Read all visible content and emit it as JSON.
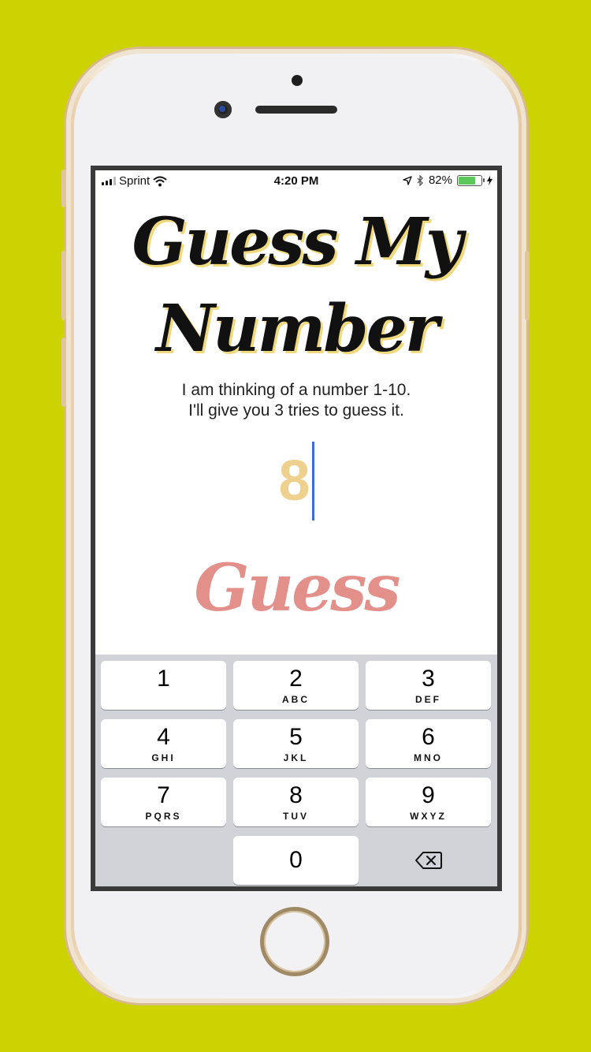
{
  "colors": {
    "background": "#cdd300",
    "title_shadow": "#f0d97c",
    "guess_value": "#efd18f",
    "guess_button": "#e4908a",
    "cursor": "#3a6bd6",
    "battery": "#5ac85a"
  },
  "status_bar": {
    "carrier": "Sprint",
    "time": "4:20 PM",
    "battery_percent": "82%",
    "battery_level": 0.82
  },
  "app": {
    "title": "Guess My Number",
    "subtitle_line1": "I am thinking of a number 1-10.",
    "subtitle_line2": "I'll give you 3 tries to guess it.",
    "guess_value": "8",
    "guess_button_label": "Guess"
  },
  "keypad": {
    "keys": [
      {
        "num": "1",
        "letters": ""
      },
      {
        "num": "2",
        "letters": "ABC"
      },
      {
        "num": "3",
        "letters": "DEF"
      },
      {
        "num": "4",
        "letters": "GHI"
      },
      {
        "num": "5",
        "letters": "JKL"
      },
      {
        "num": "6",
        "letters": "MNO"
      },
      {
        "num": "7",
        "letters": "PQRS"
      },
      {
        "num": "8",
        "letters": "TUV"
      },
      {
        "num": "9",
        "letters": "WXYZ"
      },
      {
        "num": "0",
        "letters": ""
      }
    ],
    "delete_icon": "backspace-icon"
  }
}
